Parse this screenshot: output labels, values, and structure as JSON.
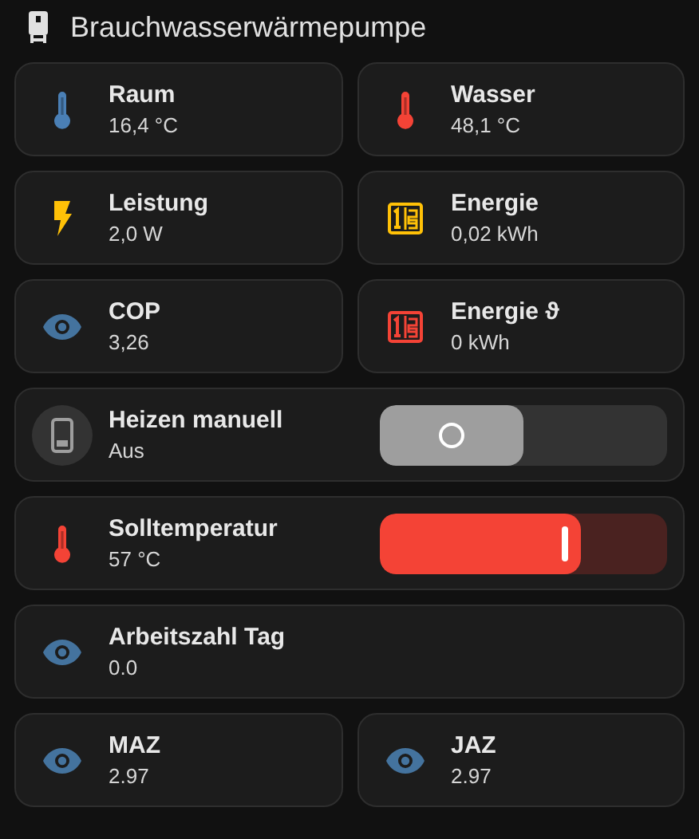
{
  "title": "Brauchwasserwärmepumpe",
  "rows": [
    [
      {
        "kind": "temperature",
        "label": "Raum",
        "value": "16,4 °C",
        "color": "#4a7fb5"
      },
      {
        "kind": "temperature",
        "label": "Wasser",
        "value": "48,1 °C",
        "color": "#f44336"
      }
    ],
    [
      {
        "kind": "power",
        "label": "Leistung",
        "value": "2,0 W",
        "color": "#ffc107"
      },
      {
        "kind": "energy",
        "label": "Energie",
        "value": "0,02 kWh",
        "color": "#ffc107"
      }
    ],
    [
      {
        "kind": "eye",
        "label": "COP",
        "value": "3,26",
        "color": "#44739e"
      },
      {
        "kind": "energy",
        "label": "Energie ϑ",
        "value": "0 kWh",
        "color": "#f44336"
      }
    ],
    [
      {
        "kind": "toggle",
        "label": "Heizen manuell",
        "value": "Aus",
        "on": false
      }
    ],
    [
      {
        "kind": "slider",
        "label": "Solltemperatur",
        "value": "57 °C",
        "color": "#f44336",
        "level": 0.7
      }
    ],
    [
      {
        "kind": "eye",
        "label": "Arbeitszahl Tag",
        "value": "0.0",
        "color": "#44739e"
      }
    ],
    [
      {
        "kind": "eye",
        "label": "MAZ",
        "value": "2.97",
        "color": "#44739e"
      },
      {
        "kind": "eye",
        "label": "JAZ",
        "value": "2.97",
        "color": "#44739e"
      }
    ]
  ]
}
